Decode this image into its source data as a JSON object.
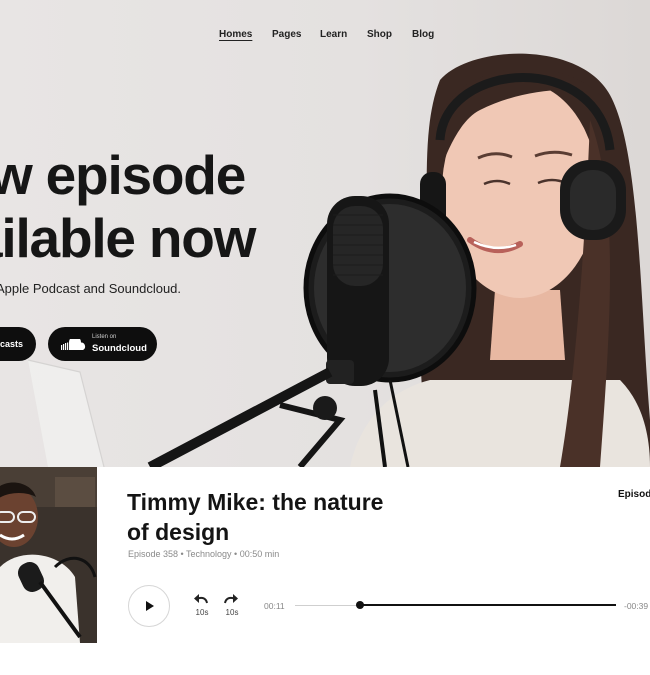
{
  "nav": {
    "items": [
      "Homes",
      "Pages",
      "Learn",
      "Shop",
      "Blog"
    ],
    "active": "Homes"
  },
  "hero": {
    "headline_line1": "w episode",
    "headline_line2": "ailable now",
    "subtitle": "Apple Podcast and Soundcloud.",
    "button_a_label": "casts",
    "button_b_small": "Listen on",
    "button_b_label": "Soundcloud"
  },
  "episode": {
    "title": "Timmy Mike: the nature of design",
    "meta": "Episode 358 • Technology • 00:50 min",
    "tag": "Episode",
    "player": {
      "rewind_label": "10s",
      "forward_label": "10s",
      "current_time": "00:11",
      "remaining_time": "-00:39",
      "progress_fraction": 0.2
    }
  },
  "colors": {
    "hero_bg": "#e6e3e2",
    "button_bg": "#0e0e0e",
    "text_dark": "#141414",
    "meta_gray": "#8a8a8a"
  },
  "icons": {
    "play": "play-icon",
    "rewind": "rewind-icon",
    "forward": "forward-icon",
    "cloud": "soundcloud-icon"
  }
}
